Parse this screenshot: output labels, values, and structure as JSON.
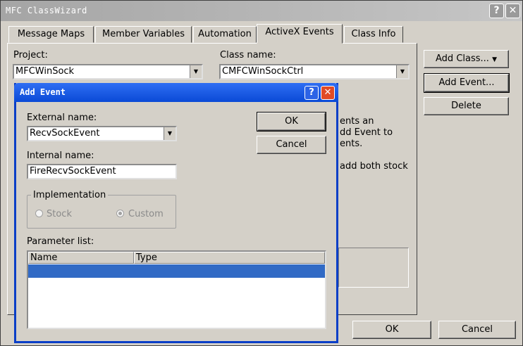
{
  "window": {
    "title": "MFC ClassWizard",
    "help": "?",
    "close": "✕"
  },
  "tabs": [
    "Message Maps",
    "Member Variables",
    "Automation",
    "ActiveX Events",
    "Class Info"
  ],
  "project": {
    "label": "Project:",
    "value": "MFCWinSock"
  },
  "class_name": {
    "label": "Class name:",
    "value": "CMFCWinSockCtrl"
  },
  "side_buttons": {
    "add_class": "Add Class...",
    "add_event": "Add Event...",
    "delete": "Delete"
  },
  "bg_text": [
    "ents an",
    "dd Event to",
    "ents.",
    "add both stock"
  ],
  "bottom_buttons": {
    "ok": "OK",
    "cancel": "Cancel"
  },
  "dialog": {
    "title": "Add Event",
    "help": "?",
    "close": "✕",
    "external_label": "External name:",
    "external_value": "RecvSockEvent",
    "internal_label": "Internal name:",
    "internal_value": "FireRecvSockEvent",
    "ok": "OK",
    "cancel": "Cancel",
    "impl_label": "Implementation",
    "stock": "Stock",
    "custom": "Custom",
    "param_label": "Parameter list:",
    "columns": [
      "Name",
      "Type"
    ]
  },
  "colors": {
    "accent": "#0a3ec7",
    "selection": "#316ac5",
    "face": "#d4d0c8"
  }
}
